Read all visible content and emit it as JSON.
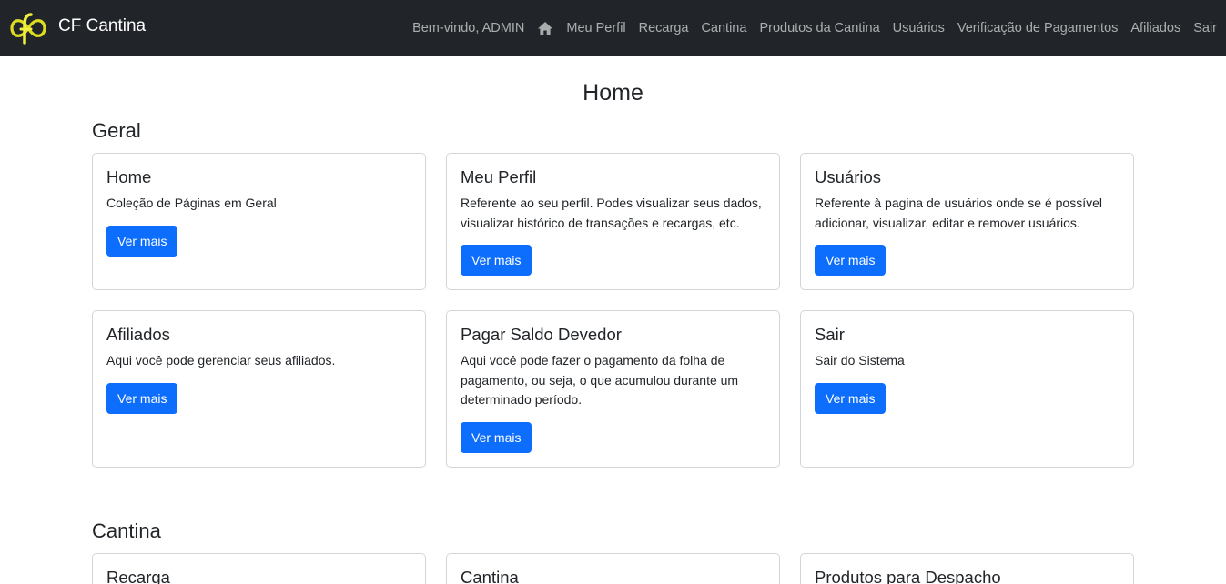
{
  "navbar": {
    "brand": "CF Cantina",
    "welcome": "Bem-vindo, ADMIN",
    "home_icon": "home-icon",
    "links": [
      "Meu Perfil",
      "Recarga",
      "Cantina",
      "Produtos da Cantina",
      "Usuários",
      "Verificação de Pagamentos",
      "Afiliados",
      "Sair"
    ]
  },
  "page": {
    "title": "Home"
  },
  "sections": [
    {
      "title": "Geral",
      "cards": [
        {
          "title": "Home",
          "text": "Coleção de Páginas em Geral",
          "button": "Ver mais"
        },
        {
          "title": "Meu Perfil",
          "text": "Referente ao seu perfil. Podes visualizar seus dados, visualizar histórico de transações e recargas, etc.",
          "button": "Ver mais"
        },
        {
          "title": "Usuários",
          "text": "Referente à pagina de usuários onde se é possível adicionar, visualizar, editar e remover usuários.",
          "button": "Ver mais"
        },
        {
          "title": "Afiliados",
          "text": "Aqui você pode gerenciar seus afiliados.",
          "button": "Ver mais"
        },
        {
          "title": "Pagar Saldo Devedor",
          "text": "Aqui você pode fazer o pagamento da folha de pagamento, ou seja, o que acumulou durante um determinado período.",
          "button": "Ver mais"
        },
        {
          "title": "Sair",
          "text": "Sair do Sistema",
          "button": "Ver mais"
        }
      ]
    },
    {
      "title": "Cantina",
      "cards": [
        {
          "title": "Recarga"
        },
        {
          "title": "Cantina"
        },
        {
          "title": "Produtos para Despacho"
        }
      ]
    }
  ],
  "colors": {
    "navbar": "#212529",
    "primary": "#0d6efd",
    "logo": "#e6e61a"
  }
}
